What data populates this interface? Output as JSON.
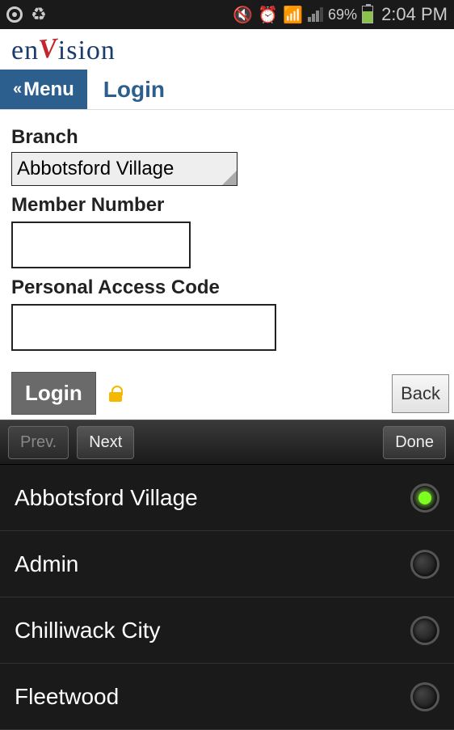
{
  "status": {
    "battery_pct": "69%",
    "time": "2:04 PM"
  },
  "logo": {
    "pre": "en",
    "check": "V",
    "post": "ision"
  },
  "nav": {
    "menu_label": "Menu",
    "title": "Login"
  },
  "form": {
    "branch_label": "Branch",
    "branch_value": "Abbotsford Village",
    "member_label": "Member Number",
    "member_value": "",
    "pac_label": "Personal Access Code",
    "pac_value": ""
  },
  "actions": {
    "login_label": "Login",
    "back_label": "Back"
  },
  "picker_nav": {
    "prev": "Prev.",
    "next": "Next",
    "done": "Done"
  },
  "picker": {
    "options": [
      {
        "label": "Abbotsford Village",
        "selected": true
      },
      {
        "label": "Admin",
        "selected": false
      },
      {
        "label": "Chilliwack City",
        "selected": false
      },
      {
        "label": "Fleetwood",
        "selected": false
      }
    ]
  }
}
